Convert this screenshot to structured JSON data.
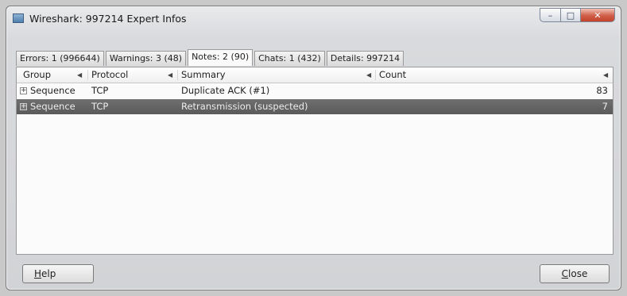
{
  "window": {
    "title": "Wireshark: 997214 Expert Infos",
    "buttons": {
      "minimize": "–",
      "maximize": "□",
      "close": "✕"
    }
  },
  "tabs": [
    {
      "label": "Errors: 1 (996644)",
      "active": false
    },
    {
      "label": "Warnings: 3 (48)",
      "active": false
    },
    {
      "label": "Notes: 2 (90)",
      "active": true
    },
    {
      "label": "Chats: 1 (432)",
      "active": false
    },
    {
      "label": "Details: 997214",
      "active": false
    }
  ],
  "table": {
    "columns": {
      "group": "Group",
      "protocol": "Protocol",
      "summary": "Summary",
      "count": "Count"
    },
    "rows": [
      {
        "expander": "+",
        "group": "Sequence",
        "protocol": "TCP",
        "summary": "Duplicate ACK (#1)",
        "count": "83",
        "selected": false
      },
      {
        "expander": "+",
        "group": "Sequence",
        "protocol": "TCP",
        "summary": "Retransmission (suspected)",
        "count": "7",
        "selected": true
      }
    ]
  },
  "footer": {
    "help_mnemonic": "H",
    "help_rest": "elp",
    "close_mnemonic": "C",
    "close_rest": "lose"
  },
  "icons": {
    "app": "wireshark-app-icon",
    "sort": "sort-arrow-icon"
  },
  "colors": {
    "selected_row": "#5f5f5f",
    "close_button": "#c2432b"
  }
}
